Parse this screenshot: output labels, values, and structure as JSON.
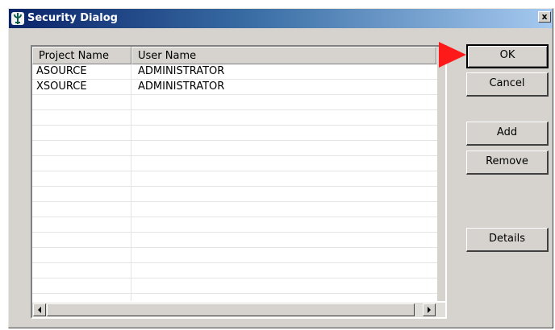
{
  "window": {
    "title": "Security Dialog",
    "close_glyph": "x"
  },
  "table": {
    "columns": [
      "Project Name",
      "User Name"
    ],
    "rows": [
      [
        "ASOURCE",
        "ADMINISTRATOR"
      ],
      [
        "XSOURCE",
        "ADMINISTRATOR"
      ]
    ]
  },
  "buttons": {
    "ok": "OK",
    "cancel": "Cancel",
    "add": "Add",
    "remove": "Remove",
    "details": "Details"
  },
  "colors": {
    "pointer": "#ff1a1a",
    "title_start": "#0a246a",
    "title_end": "#a6caf0"
  }
}
